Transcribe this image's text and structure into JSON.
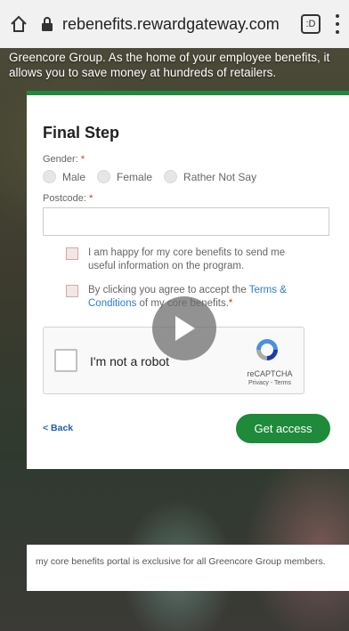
{
  "browser": {
    "url": "rebenefits.rewardgateway.com",
    "tabs_count": ":D"
  },
  "intro": {
    "text": "Greencore Group. As the home of your employee benefits, it allows you to save money at hundreds of retailers."
  },
  "form": {
    "title": "Final Step",
    "gender_label": "Gender:",
    "required_mark": "*",
    "gender_options": [
      "Male",
      "Female",
      "Rather Not Say"
    ],
    "postcode_label": "Postcode:",
    "postcode_value": "",
    "checkbox_info_text": "I am happy for my core benefits to send me useful information on the program.",
    "checkbox_terms_prefix": "By clicking you agree to accept the ",
    "checkbox_terms_link": "Terms & Conditions",
    "checkbox_terms_suffix": " of my core benefits.",
    "back_label": "< Back",
    "submit_label": "Get access"
  },
  "recaptcha": {
    "label": "I'm not a robot",
    "brand": "reCAPTCHA",
    "privacy": "Privacy - Terms"
  },
  "footer": {
    "text": "my core benefits portal is exclusive for all Greencore Group members."
  },
  "colors": {
    "accent": "#1e8a3a",
    "link": "#2b7ccf",
    "required": "#dd3333"
  }
}
